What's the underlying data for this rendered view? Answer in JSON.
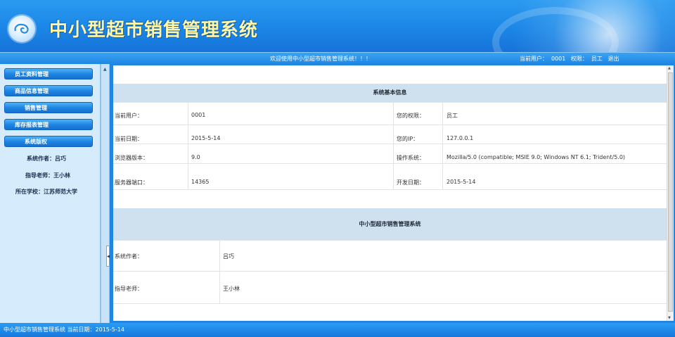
{
  "header": {
    "title": "中小型超市销售管理系统"
  },
  "infobar": {
    "welcome": "欢迎使用中小型超市销售管理系统！！！",
    "current_user_label": "当前用户：",
    "current_user": "0001",
    "role_label": "权限：",
    "role": "员工",
    "logout": "退出"
  },
  "sidebar": {
    "items": [
      {
        "label": "员工资料管理"
      },
      {
        "label": "商品信息管理"
      },
      {
        "label": "销售管理"
      },
      {
        "label": "库存报表管理"
      },
      {
        "label": "系统版权"
      }
    ],
    "info": [
      "系统作者：吕巧",
      "指导老师：王小林",
      "所在学校：江苏师范大学"
    ]
  },
  "main": {
    "section1": {
      "title": "系统基本信息",
      "rows": [
        {
          "k1": "当前用户：",
          "v1": "0001",
          "k2": "您的权限：",
          "v2": "员工"
        },
        {
          "k1": "当前日期：",
          "v1": "2015-5-14",
          "k2": "您的IP：",
          "v2": "127.0.0.1"
        },
        {
          "k1": "浏览器版本：",
          "v1": "9.0",
          "k2": "操作系统：",
          "v2": "Mozilla/5.0 (compatible; MSIE 9.0; Windows NT 6.1; Trident/5.0)"
        },
        {
          "k1": "服务器端口：",
          "v1": "14365",
          "k2": "开发日期：",
          "v2": "2015-5-14"
        }
      ]
    },
    "section2": {
      "title": "中小型超市销售管理系统",
      "rows": [
        {
          "k": "系统作者：",
          "v": "吕巧"
        },
        {
          "k": "指导老师：",
          "v": "王小林"
        }
      ]
    }
  },
  "footer": {
    "text": "中小型超市销售管理系统 当前日期：2015-5-14"
  }
}
